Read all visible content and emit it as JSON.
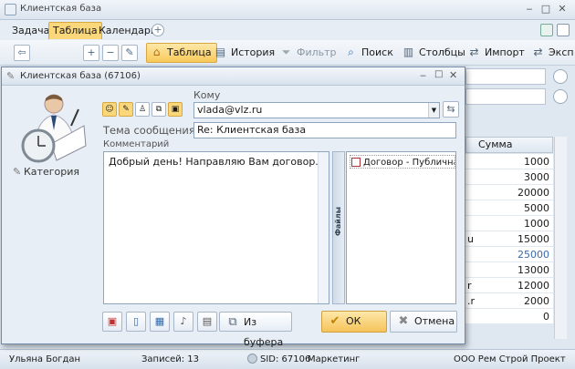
{
  "window": {
    "title": "Клиентская база",
    "icon": "app-icon"
  },
  "tabs": [
    {
      "label": "Задача"
    },
    {
      "label": "Таблица"
    },
    {
      "label": "Календарь"
    }
  ],
  "toolbar": {
    "table": "Таблица",
    "history": "История",
    "filter": "Фильтр",
    "search": "Поиск",
    "columns": "Столбцы",
    "import": "Импорт",
    "export": "Эксп"
  },
  "grid": {
    "header": "Сумма оплаты",
    "rows": [
      {
        "left": "",
        "value": "1000",
        "color": "#1a1a1a"
      },
      {
        "left": "",
        "value": "3000",
        "color": "#1a1a1a"
      },
      {
        "left": "",
        "value": "20000",
        "color": "#1a1a1a"
      },
      {
        "left": "",
        "value": "5000",
        "color": "#1a1a1a"
      },
      {
        "left": "",
        "value": "1000",
        "color": "#1a1a1a"
      },
      {
        "left": "u",
        "value": "15000",
        "color": "#1a1a1a"
      },
      {
        "left": "",
        "value": "25000",
        "color": "#3a6ab0"
      },
      {
        "left": "",
        "value": "13000",
        "color": "#1a1a1a"
      },
      {
        "left": "r",
        "value": "12000",
        "color": "#1a1a1a"
      },
      {
        "left": ".r",
        "value": "2000",
        "color": "#1a1a1a"
      },
      {
        "left": "",
        "value": "0",
        "color": "#1a1a1a"
      }
    ]
  },
  "status": {
    "user": "Ульяна Богдан",
    "records": "Записей: 13",
    "sid": "SID: 67106",
    "category": "Маркетинг",
    "company": "ООО Рем Строй Проект"
  },
  "dialog": {
    "title": "Клиентская база (67106)",
    "category": "Категория",
    "to_label": "Кому",
    "to_value": "vlada@vlz.ru",
    "subject_label": "Тема сообщения",
    "subject_value": "Re: Клиентская база",
    "comment_label": "Комментарий",
    "comment_value": "Добрый день! Направляю Вам договор.",
    "files_label": "Файлы",
    "files": [
      {
        "name": "Договор - Публичная офе"
      }
    ],
    "from_buffer": "Из буфера",
    "ok": "ОК",
    "cancel": "Отмена"
  }
}
